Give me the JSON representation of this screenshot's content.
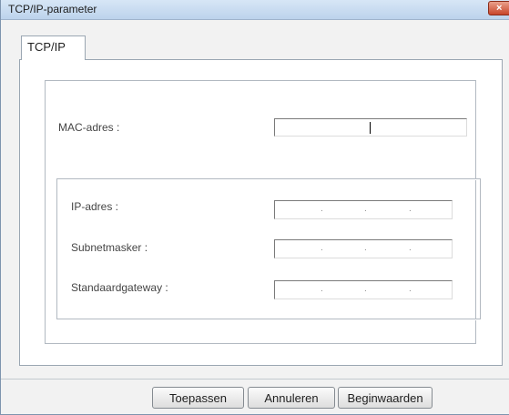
{
  "window": {
    "title": "TCP/IP-parameter",
    "close_glyph": "×",
    "colors": {
      "titlebar": "#c8dcf1",
      "close": "#d2573c"
    }
  },
  "tabs": [
    {
      "label": "TCP/IP",
      "selected": true
    }
  ],
  "form": {
    "mac_label": "MAC-adres :",
    "mac_value": "",
    "ip_label": "IP-adres :",
    "ip_value": "   .   .   .",
    "subnet_label": "Subnetmasker :",
    "subnet_value": "   .   .   .",
    "gateway_label": "Standaardgateway :",
    "gateway_value": "   .   .   ."
  },
  "buttons": {
    "apply": "Toepassen",
    "cancel": "Annuleren",
    "defaults": "Beginwaarden"
  }
}
